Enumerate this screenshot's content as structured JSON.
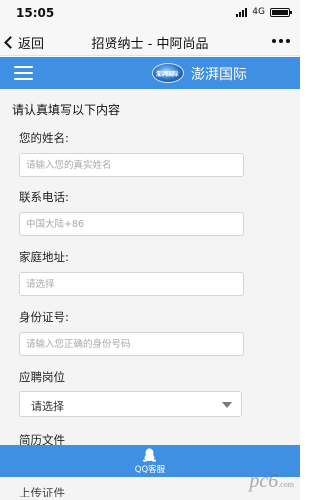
{
  "status_bar": {
    "time": "15:05",
    "network": "4G"
  },
  "nav": {
    "back_label": "返回",
    "title": "招贤纳士 - 中阿尚品"
  },
  "header": {
    "brand_name": "澎湃国际",
    "logo_text": "澎湃国际"
  },
  "form": {
    "heading": "请认真填写以下内容",
    "name": {
      "label": "您的姓名:",
      "placeholder": "请输入您的真实姓名"
    },
    "phone": {
      "label": "联系电话:",
      "placeholder": "中国大陆+86"
    },
    "address": {
      "label": "家庭地址:",
      "placeholder": "请选择"
    },
    "id_number": {
      "label": "身份证号:",
      "placeholder": "请输入您正确的身份号码"
    },
    "position": {
      "label": "应聘岗位",
      "selected": "请选择"
    },
    "resume": {
      "label": "简历文件"
    }
  },
  "bottom_bar": {
    "qq_label": "QQ客服"
  },
  "peek": {
    "text": "上传证件"
  },
  "watermark": {
    "text": "pc6",
    "sub": ".com"
  },
  "colors": {
    "accent": "#3f8fe3",
    "background": "#f4f4f4"
  },
  "icons": {
    "back": "chevron-left-icon",
    "menu": "hamburger-menu-icon",
    "more": "more-dots-icon",
    "qq": "qq-penguin-icon",
    "caret": "caret-down-icon"
  }
}
